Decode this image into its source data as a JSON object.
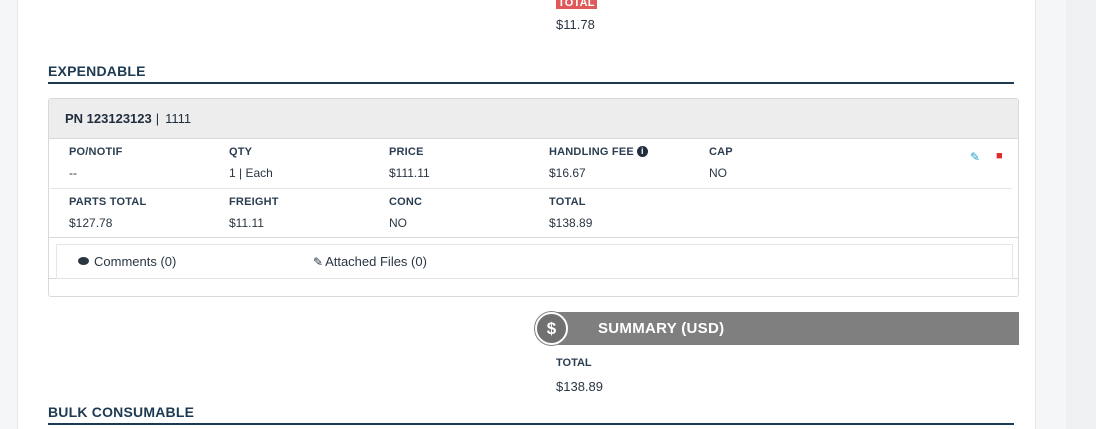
{
  "top": {
    "total_label": "TOTAL",
    "total_value": "$11.78"
  },
  "expendable": {
    "title": "EXPENDABLE",
    "part": {
      "pn": "PN 123123123",
      "separator": "|",
      "desc": "1111"
    },
    "row1": [
      {
        "label": "PO/NOTIF",
        "value": "--"
      },
      {
        "label": "QTY",
        "value": "1 | Each"
      },
      {
        "label": "PRICE",
        "value": "$111.11"
      },
      {
        "label": "HANDLING FEE",
        "value": "$16.67"
      },
      {
        "label": "CAP",
        "value": "NO"
      }
    ],
    "row2": [
      {
        "label": "PARTS TOTAL",
        "value": "$127.78"
      },
      {
        "label": "FREIGHT",
        "value": "$11.11"
      },
      {
        "label": "CONC",
        "value": "NO"
      },
      {
        "label": "TOTAL",
        "value": "$138.89"
      }
    ],
    "comments_label": "Comments (0)",
    "files_label": "Attached Files (0)"
  },
  "summary": {
    "title": "SUMMARY (USD)",
    "total_label": "TOTAL",
    "total_value": "$138.89"
  },
  "bulk": {
    "title": "BULK CONSUMABLE"
  },
  "icons": {
    "info": "info-circle-icon",
    "edit": "pencil-icon",
    "delete": "trash-icon",
    "comment": "comment-icon",
    "attach": "paperclip-icon",
    "currency": "dollar-icon"
  },
  "colors": {
    "heading": "#1e3a52",
    "summary_bar": "#7f7f7f",
    "edit": "#1fa3c9",
    "delete": "#e02b2b",
    "total_tag": "#e05a5a"
  }
}
